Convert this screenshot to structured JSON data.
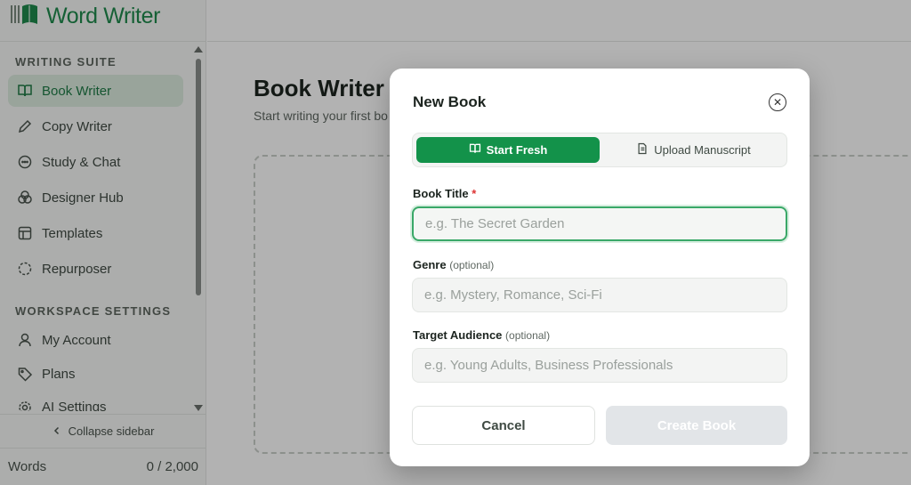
{
  "app": {
    "name": "Word Writer"
  },
  "sidebar": {
    "section_writing": "WRITING SUITE",
    "writing_items": [
      {
        "label": "Book Writer",
        "icon": "book-open-icon",
        "active": true
      },
      {
        "label": "Copy Writer",
        "icon": "pencil-icon"
      },
      {
        "label": "Study & Chat",
        "icon": "chat-icon"
      },
      {
        "label": "Designer Hub",
        "icon": "palette-icon"
      },
      {
        "label": "Templates",
        "icon": "template-icon"
      },
      {
        "label": "Repurposer",
        "icon": "loader-icon"
      }
    ],
    "section_workspace": "WORKSPACE SETTINGS",
    "workspace_items": [
      {
        "label": "My Account",
        "icon": "user-icon"
      },
      {
        "label": "Plans",
        "icon": "tag-icon"
      },
      {
        "label": "AI Settings",
        "icon": "gear-icon"
      }
    ],
    "collapse_label": "Collapse sidebar",
    "words_label": "Words",
    "words_count": "0 / 2,000"
  },
  "main": {
    "title": "Book Writer",
    "subtitle": "Start writing your first bo"
  },
  "modal": {
    "title": "New Book",
    "tabs": [
      {
        "label": "Start Fresh",
        "icon": "book-open-icon",
        "active": true
      },
      {
        "label": "Upload Manuscript",
        "icon": "document-icon"
      }
    ],
    "book_title_label": "Book Title",
    "required_mark": "*",
    "book_title_placeholder": "e.g. The Secret Garden",
    "genre_label": "Genre",
    "genre_optional": "(optional)",
    "genre_placeholder": "e.g. Mystery, Romance, Sci-Fi",
    "audience_label": "Target Audience",
    "audience_optional": "(optional)",
    "audience_placeholder": "e.g. Young Adults, Business Professionals",
    "cancel_label": "Cancel",
    "create_label": "Create Book"
  },
  "colors": {
    "brand": "#1f8a4c",
    "accent": "#13924a",
    "active_bg": "#dcebdf"
  }
}
